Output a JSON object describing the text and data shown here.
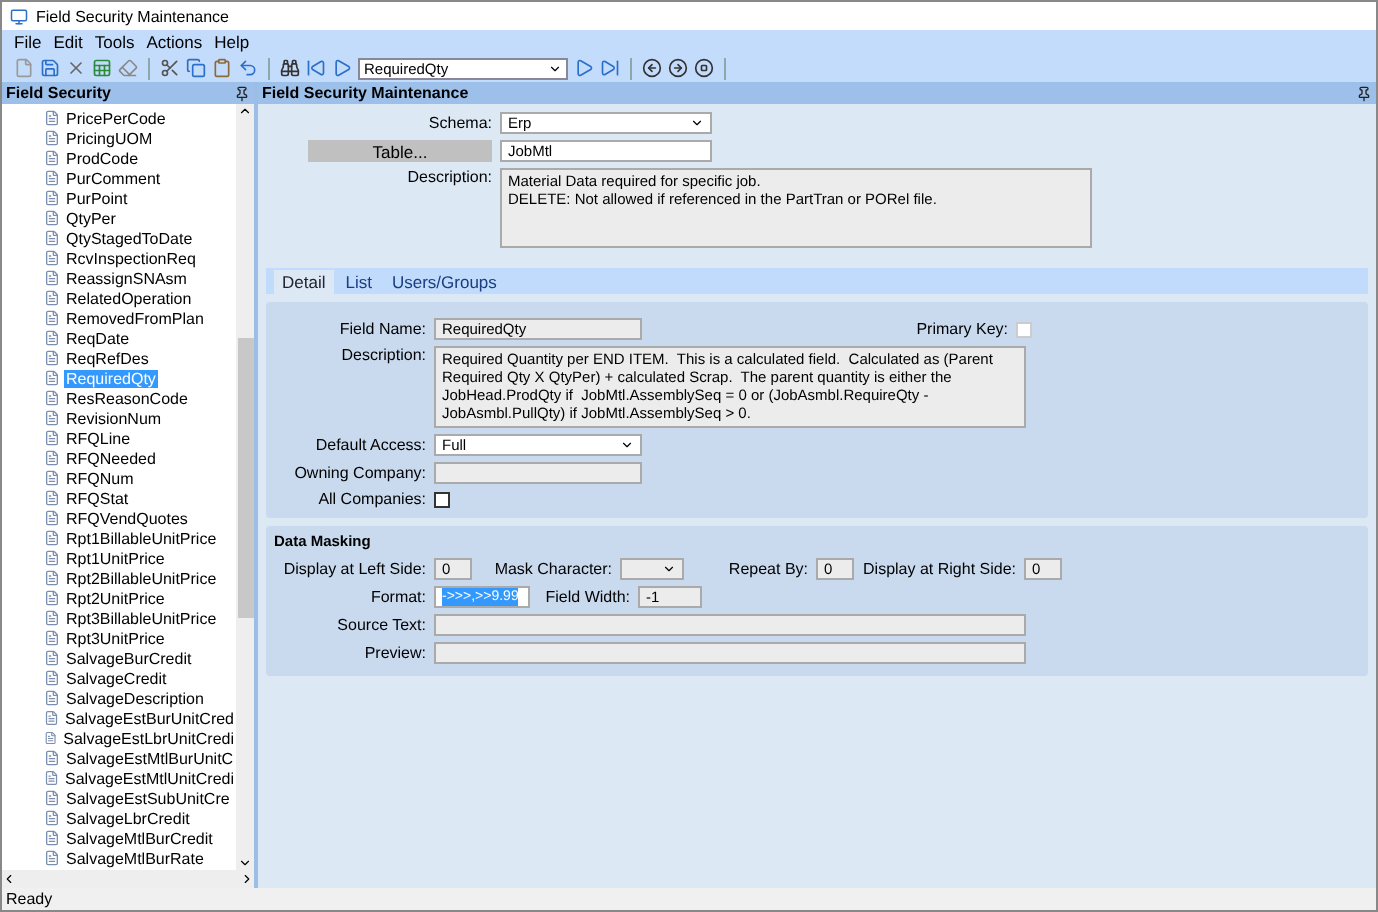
{
  "window": {
    "title": "Field Security Maintenance"
  },
  "menu": [
    "File",
    "Edit",
    "Tools",
    "Actions",
    "Help"
  ],
  "toolbar": {
    "record_value": "RequiredQty"
  },
  "sidebar": {
    "title": "Field Security",
    "items": [
      {
        "label": "PricePerCode",
        "selected": false
      },
      {
        "label": "PricingUOM",
        "selected": false
      },
      {
        "label": "ProdCode",
        "selected": false
      },
      {
        "label": "PurComment",
        "selected": false
      },
      {
        "label": "PurPoint",
        "selected": false
      },
      {
        "label": "QtyPer",
        "selected": false
      },
      {
        "label": "QtyStagedToDate",
        "selected": false
      },
      {
        "label": "RcvInspectionReq",
        "selected": false
      },
      {
        "label": "ReassignSNAsm",
        "selected": false
      },
      {
        "label": "RelatedOperation",
        "selected": false
      },
      {
        "label": "RemovedFromPlan",
        "selected": false
      },
      {
        "label": "ReqDate",
        "selected": false
      },
      {
        "label": "ReqRefDes",
        "selected": false
      },
      {
        "label": "RequiredQty",
        "selected": true
      },
      {
        "label": "ResReasonCode",
        "selected": false
      },
      {
        "label": "RevisionNum",
        "selected": false
      },
      {
        "label": "RFQLine",
        "selected": false
      },
      {
        "label": "RFQNeeded",
        "selected": false
      },
      {
        "label": "RFQNum",
        "selected": false
      },
      {
        "label": "RFQStat",
        "selected": false
      },
      {
        "label": "RFQVendQuotes",
        "selected": false
      },
      {
        "label": "Rpt1BillableUnitPrice",
        "selected": false
      },
      {
        "label": "Rpt1UnitPrice",
        "selected": false
      },
      {
        "label": "Rpt2BillableUnitPrice",
        "selected": false
      },
      {
        "label": "Rpt2UnitPrice",
        "selected": false
      },
      {
        "label": "Rpt3BillableUnitPrice",
        "selected": false
      },
      {
        "label": "Rpt3UnitPrice",
        "selected": false
      },
      {
        "label": "SalvageBurCredit",
        "selected": false
      },
      {
        "label": "SalvageCredit",
        "selected": false
      },
      {
        "label": "SalvageDescription",
        "selected": false
      },
      {
        "label": "SalvageEstBurUnitCred",
        "selected": false
      },
      {
        "label": "SalvageEstLbrUnitCredi",
        "selected": false
      },
      {
        "label": "SalvageEstMtlBurUnitC",
        "selected": false
      },
      {
        "label": "SalvageEstMtlUnitCredi",
        "selected": false
      },
      {
        "label": "SalvageEstSubUnitCre",
        "selected": false
      },
      {
        "label": "SalvageLbrCredit",
        "selected": false
      },
      {
        "label": "SalvageMtlBurCredit",
        "selected": false
      },
      {
        "label": "SalvageMtlBurRate",
        "selected": false
      }
    ]
  },
  "main": {
    "title": "Field Security Maintenance",
    "schema": {
      "label": "Schema:",
      "value": "Erp"
    },
    "table": {
      "button": "Table...",
      "value": "JobMtl"
    },
    "description": {
      "label": "Description:",
      "value": "Material Data required for specific job.\nDELETE: Not allowed if referenced in the PartTran or PORel file."
    },
    "tabs": [
      {
        "label": "Detail",
        "selected": true
      },
      {
        "label": "List",
        "selected": false
      },
      {
        "label": "Users/Groups",
        "selected": false
      }
    ],
    "detail": {
      "field_name": {
        "label": "Field Name:",
        "value": "RequiredQty"
      },
      "primary_key": {
        "label": "Primary Key:",
        "checked": false,
        "disabled": true
      },
      "description": {
        "label": "Description:",
        "value": "Required Quantity per END ITEM.  This is a calculated field.  Calculated as (Parent Required Qty X QtyPer) + calculated Scrap.  The parent quantity is either the JobHead.ProdQty if  JobMtl.AssemblySeq = 0 or (JobAsmbl.RequireQty - JobAsmbl.PullQty) if JobMtl.AssemblySeq > 0."
      },
      "default_access": {
        "label": "Default Access:",
        "value": "Full"
      },
      "owning_company": {
        "label": "Owning Company:"
      },
      "all_companies": {
        "label": "All Companies:",
        "checked": false,
        "disabled": false
      }
    },
    "data_masking": {
      "title": "Data Masking",
      "left_side": {
        "label": "Display at Left Side:",
        "value": "0"
      },
      "mask_character": {
        "label": "Mask Character:"
      },
      "repeat_by": {
        "label": "Repeat By:",
        "value": "0"
      },
      "right_side": {
        "label": "Display at Right Side:",
        "value": "0"
      },
      "format": {
        "label": "Format:",
        "value": "->>>,>>9.99"
      },
      "field_width": {
        "label": "Field Width:",
        "value": "-1"
      },
      "source_text": {
        "label": "Source Text:"
      },
      "preview": {
        "label": "Preview:"
      }
    }
  },
  "status_bar": "Ready"
}
